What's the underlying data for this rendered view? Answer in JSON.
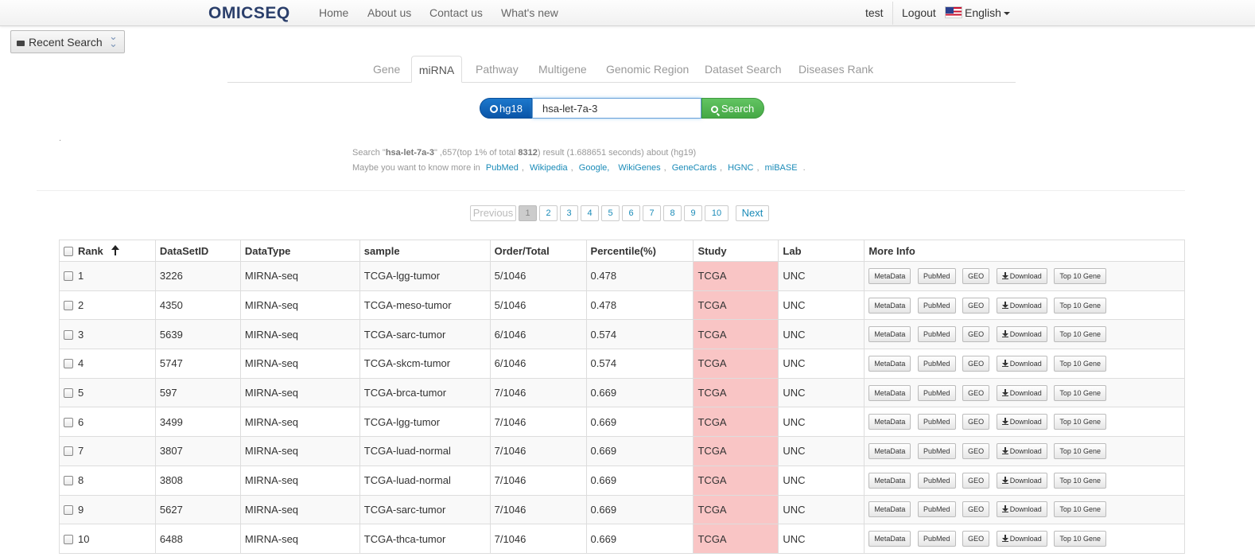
{
  "brand": "OMICSEQ",
  "nav": {
    "home": "Home",
    "about": "About us",
    "contact": "Contact us",
    "whats_new": "What's new",
    "user": "test",
    "logout": "Logout",
    "language": "English"
  },
  "recent_search": "Recent Search",
  "tabs": [
    "Gene",
    "miRNA",
    "Pathway",
    "Multigene",
    "Genomic Region",
    "Dataset Search",
    "Diseases Rank"
  ],
  "active_tab": "miRNA",
  "search": {
    "genome": "hg18",
    "value": "hsa-let-7a-3",
    "button": "Search"
  },
  "dot": ".",
  "info": {
    "search_prefix": "Search \"",
    "query": "hsa-let-7a-3",
    "mid": "\" ,657(top 1% of total ",
    "total": "8312",
    "suffix": ") result (1.688651 seconds) about (hg19)",
    "more_prefix": "Maybe you want to know more in",
    "links": [
      "PubMed",
      "Wikipedia",
      "Google,",
      "WikiGenes",
      "GeneCards",
      "HGNC",
      "miBASE"
    ],
    "more_suffix": "."
  },
  "pagination": {
    "previous": "Previous",
    "pages": [
      "1",
      "2",
      "3",
      "4",
      "5",
      "6",
      "7",
      "8",
      "9",
      "10"
    ],
    "current": "1",
    "next": "Next"
  },
  "table": {
    "columns": [
      "Rank",
      "DataSetID",
      "DataType",
      "sample",
      "Order/Total",
      "Percentile(%)",
      "Study",
      "Lab",
      "More Info"
    ],
    "action_buttons": [
      "MetaData",
      "PubMed",
      "GEO",
      "Download",
      "Top 10 Gene"
    ],
    "study_color": "#f9c5c5",
    "rows": [
      {
        "rank": "1",
        "id": "3226",
        "type": "MIRNA-seq",
        "sample": "TCGA-lgg-tumor",
        "order": "5/1046",
        "pct": "0.478",
        "study": "TCGA",
        "lab": "UNC"
      },
      {
        "rank": "2",
        "id": "4350",
        "type": "MIRNA-seq",
        "sample": "TCGA-meso-tumor",
        "order": "5/1046",
        "pct": "0.478",
        "study": "TCGA",
        "lab": "UNC"
      },
      {
        "rank": "3",
        "id": "5639",
        "type": "MIRNA-seq",
        "sample": "TCGA-sarc-tumor",
        "order": "6/1046",
        "pct": "0.574",
        "study": "TCGA",
        "lab": "UNC"
      },
      {
        "rank": "4",
        "id": "5747",
        "type": "MIRNA-seq",
        "sample": "TCGA-skcm-tumor",
        "order": "6/1046",
        "pct": "0.574",
        "study": "TCGA",
        "lab": "UNC"
      },
      {
        "rank": "5",
        "id": "597",
        "type": "MIRNA-seq",
        "sample": "TCGA-brca-tumor",
        "order": "7/1046",
        "pct": "0.669",
        "study": "TCGA",
        "lab": "UNC"
      },
      {
        "rank": "6",
        "id": "3499",
        "type": "MIRNA-seq",
        "sample": "TCGA-lgg-tumor",
        "order": "7/1046",
        "pct": "0.669",
        "study": "TCGA",
        "lab": "UNC"
      },
      {
        "rank": "7",
        "id": "3807",
        "type": "MIRNA-seq",
        "sample": "TCGA-luad-normal",
        "order": "7/1046",
        "pct": "0.669",
        "study": "TCGA",
        "lab": "UNC"
      },
      {
        "rank": "8",
        "id": "3808",
        "type": "MIRNA-seq",
        "sample": "TCGA-luad-normal",
        "order": "7/1046",
        "pct": "0.669",
        "study": "TCGA",
        "lab": "UNC"
      },
      {
        "rank": "9",
        "id": "5627",
        "type": "MIRNA-seq",
        "sample": "TCGA-sarc-tumor",
        "order": "7/1046",
        "pct": "0.669",
        "study": "TCGA",
        "lab": "UNC"
      },
      {
        "rank": "10",
        "id": "6488",
        "type": "MIRNA-seq",
        "sample": "TCGA-thca-tumor",
        "order": "7/1046",
        "pct": "0.669",
        "study": "TCGA",
        "lab": "UNC"
      }
    ]
  }
}
